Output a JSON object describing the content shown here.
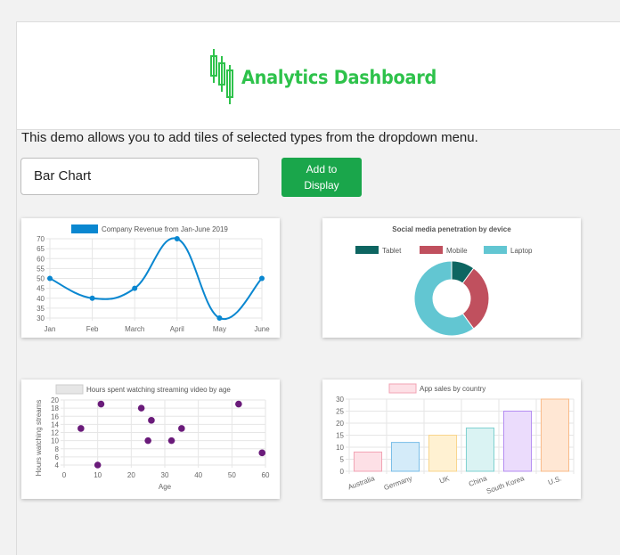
{
  "header": {
    "title": "Analytics Dashboard"
  },
  "intro": {
    "text": "This demo allows you to add tiles of selected types from the dropdown menu."
  },
  "controls": {
    "selected_type": "Bar Chart",
    "add_button_label": "Add to\nDisplay",
    "add_button_color": "#1aa64b"
  },
  "charts": {
    "line": {
      "chart_data": {
        "type": "line",
        "title": "Company Revenue from Jan-June 2019",
        "legend": "Company Revenue from Jan-June 2019",
        "legend_position": "top",
        "categories": [
          "Jan",
          "Feb",
          "March",
          "April",
          "May",
          "June"
        ],
        "values": [
          50,
          40,
          45,
          70,
          30,
          50
        ],
        "ylim": [
          30,
          70
        ],
        "yticks": [
          30,
          35,
          40,
          45,
          50,
          55,
          60,
          65,
          70
        ],
        "color": "#0a87d0",
        "grid": true
      }
    },
    "donut": {
      "chart_data": {
        "type": "pie",
        "title": "Social media penetration by device",
        "legend_position": "top",
        "labels": [
          "Tablet",
          "Mobile",
          "Laptop"
        ],
        "values": [
          10,
          30,
          60
        ],
        "colors": [
          "#0d6561",
          "#c0505e",
          "#62c6d2"
        ]
      }
    },
    "scatter": {
      "chart_data": {
        "type": "scatter",
        "title": "Hours spent watching streaming video by age",
        "legend": "Hours spent watching streaming video by age",
        "legend_position": "top",
        "xlabel": "Age",
        "ylabel": "Hours watching streams",
        "xlim": [
          0,
          60
        ],
        "ylim": [
          4,
          20
        ],
        "xticks": [
          0,
          10,
          20,
          30,
          40,
          50,
          60
        ],
        "yticks": [
          4,
          6,
          8,
          10,
          12,
          14,
          16,
          18,
          20
        ],
        "points": [
          [
            5,
            13
          ],
          [
            10,
            4
          ],
          [
            11,
            19
          ],
          [
            23,
            18
          ],
          [
            25,
            10
          ],
          [
            26,
            15
          ],
          [
            32,
            10
          ],
          [
            35,
            13
          ],
          [
            52,
            19
          ],
          [
            59,
            7
          ]
        ],
        "color": "#6a1b7a",
        "grid": true
      }
    },
    "bar": {
      "chart_data": {
        "type": "bar",
        "title": "App sales by country",
        "legend": "App sales by country",
        "legend_position": "top",
        "categories": [
          "Australia",
          "Germany",
          "UK",
          "China",
          "South Korea",
          "U.S."
        ],
        "values": [
          8,
          12,
          15,
          18,
          25,
          30
        ],
        "ylim": [
          0,
          30
        ],
        "yticks": [
          0,
          5,
          10,
          15,
          20,
          25,
          30
        ],
        "fills": [
          "#fde0e6",
          "#d4ebf9",
          "#fff1d2",
          "#daf3f3",
          "#ebdcfc",
          "#ffe7d4"
        ],
        "strokes": [
          "#f2a3b4",
          "#79bde8",
          "#f9d58c",
          "#7fd1d0",
          "#b48cf2",
          "#f9bb88"
        ],
        "legend_fill": "#fde0e6",
        "legend_stroke": "#f2a3b4",
        "grid": true
      }
    }
  }
}
